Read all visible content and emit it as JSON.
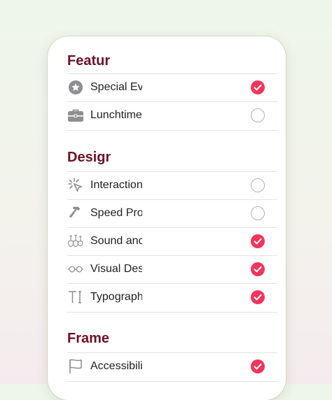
{
  "sections": [
    {
      "title": "Featur",
      "items": [
        {
          "label": "Special Ev",
          "icon": "star-badge-icon",
          "selected": true
        },
        {
          "label": "Lunchtime",
          "icon": "briefcase-icon",
          "selected": false
        }
      ]
    },
    {
      "title": "Design",
      "items": [
        {
          "label": "Interaction",
          "icon": "cursor-click-icon",
          "selected": false
        },
        {
          "label": "Speed Pro",
          "icon": "hammer-icon",
          "selected": false
        },
        {
          "label": "Sound anc",
          "icon": "instruments-icon",
          "selected": true
        },
        {
          "label": "Visual Des",
          "icon": "eyeglasses-icon",
          "selected": true
        },
        {
          "label": "Typograph",
          "icon": "text-cursor-icon",
          "selected": true
        }
      ]
    },
    {
      "title": "Frame",
      "items": [
        {
          "label": "Accessibili",
          "icon": "flag-icon",
          "selected": true
        }
      ]
    }
  ],
  "colors": {
    "accent": "#f0365c",
    "heading": "#6e1227"
  }
}
